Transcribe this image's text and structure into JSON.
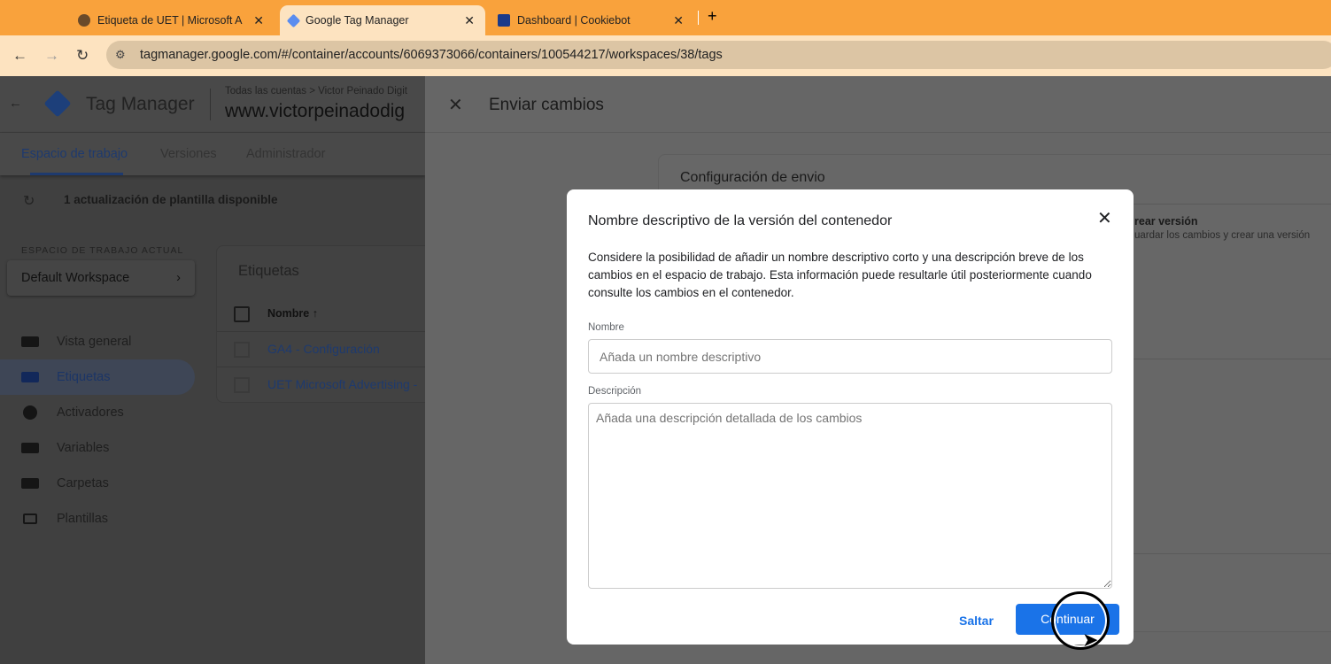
{
  "browser": {
    "tabs": [
      {
        "title": "Etiqueta de UET | Microsoft A",
        "icon": "globe-icon"
      },
      {
        "title": "Google Tag Manager",
        "icon": "gtm-icon",
        "active": true
      },
      {
        "title": "Dashboard | Cookiebot",
        "icon": "cookiebot-icon"
      }
    ],
    "new_tab": "+",
    "close": "✕",
    "url": "tagmanager.google.com/#/container/accounts/6069373066/containers/100544217/workspaces/38/tags"
  },
  "app": {
    "product": "Tag Manager",
    "breadcrumb": "Todas las cuentas > Victor Peinado Digit",
    "container": "www.victorpeinadodig",
    "tabs": [
      "Espacio de trabajo",
      "Versiones",
      "Administrador"
    ],
    "update_notice": "1 actualización de plantilla disponible",
    "workspace_label": "ESPACIO DE TRABAJO ACTUAL",
    "workspace": "Default Workspace",
    "nav": [
      "Vista general",
      "Etiquetas",
      "Activadores",
      "Variables",
      "Carpetas",
      "Plantillas"
    ],
    "table_title": "Etiquetas",
    "col_name": "Nombre",
    "rows": [
      "GA4 - Configuración",
      "UET Microsoft Advertising -"
    ]
  },
  "panel": {
    "title": "Enviar cambios",
    "section": "Configuración de envio",
    "option_title": "rear versión",
    "option_desc": "uardar los cambios y crear una versión"
  },
  "dialog": {
    "title": "Nombre descriptivo de la versión del contenedor",
    "body": "Considere la posibilidad de añadir un nombre descriptivo corto y una descripción breve de los cambios en el espacio de trabajo. Esta información puede resultarle útil posteriormente cuando consulte los cambios en el contenedor.",
    "name_label": "Nombre",
    "name_placeholder": "Añada un nombre descriptivo",
    "desc_label": "Descripción",
    "desc_placeholder": "Añada una descripción detallada de los cambios",
    "skip": "Saltar",
    "continue": "Continuar",
    "accent": "#1a73e8"
  }
}
